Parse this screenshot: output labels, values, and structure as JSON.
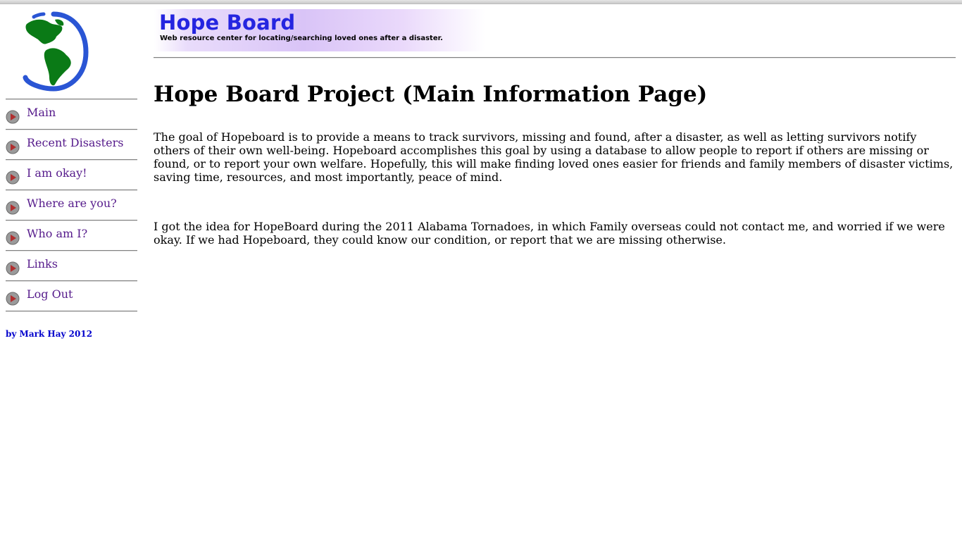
{
  "header": {
    "title": "Hope Board",
    "subtitle": "Web resource center for locating/searching loved ones after a disaster."
  },
  "logo": {
    "icon": "globe-icon",
    "land_color": "#0a7a16",
    "ring_color": "#2a55d4"
  },
  "sidebar": {
    "items": [
      {
        "label": "Main"
      },
      {
        "label": "Recent Disasters"
      },
      {
        "label": "I am okay!"
      },
      {
        "label": "Where are you?"
      },
      {
        "label": "Who am I?"
      },
      {
        "label": "Links"
      },
      {
        "label": "Log Out"
      }
    ],
    "credit": "by Mark Hay 2012"
  },
  "main": {
    "title": "Hope Board Project (Main Information Page)",
    "paragraphs": [
      "The goal of Hopeboard is to provide a means to track survivors, missing and found, after a disaster, as well as letting survivors notify others of their own well-being. Hopeboard accomplishes this goal by using a database to allow people to report if others are missing or found, or to report your own welfare. Hopefully, this will make finding loved ones easier for friends and family members of disaster victims, saving time, resources, and most importantly, peace of mind.",
      "I got the idea for HopeBoard during the 2011 Alabama Tornadoes, in which Family overseas could not contact me, and worried if we were okay. If we had Hopeboard, they could know our condition, or report that we are missing otherwise."
    ]
  },
  "colors": {
    "link": "#551a8b",
    "banner_title": "#2525e0",
    "credit": "#0000cc"
  }
}
